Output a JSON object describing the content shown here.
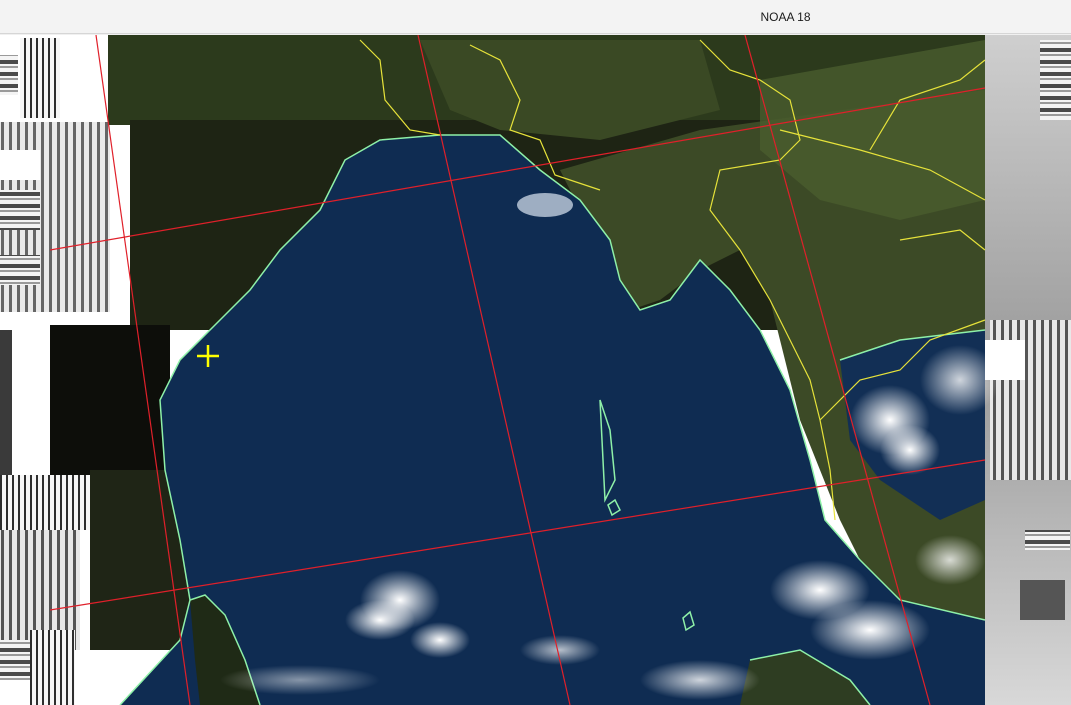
{
  "window": {
    "title": "NOAA 18"
  },
  "image": {
    "subject": "satellite-image",
    "colors": {
      "ocean": "#0f2c52",
      "land_dark": "#1a1f12",
      "land_green": "#3a4a22",
      "coastline": "#8ef0a8",
      "borders": "#e6e23a",
      "grid": "#e0202a",
      "marker": "#ffff00",
      "cloud": "#f2f4f8",
      "noise_light": "#f5f5f5",
      "noise_dark": "#3c3c3c"
    },
    "marker_icon": "crosshair-plus-icon"
  }
}
